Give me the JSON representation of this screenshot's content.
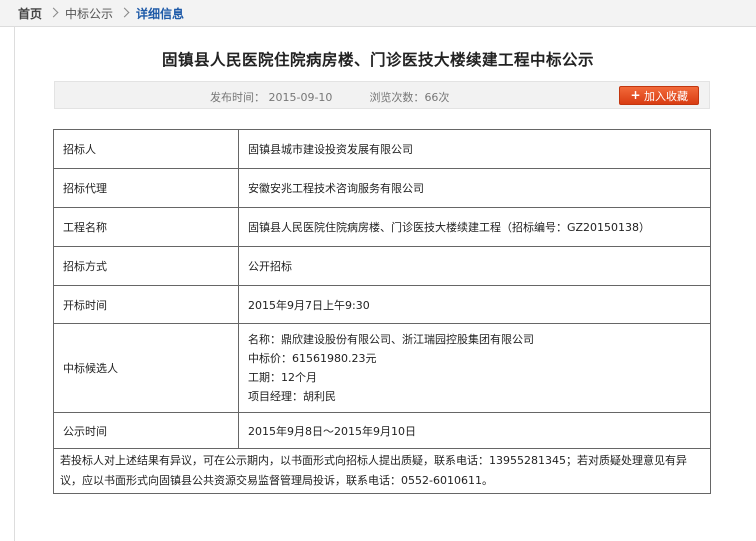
{
  "breadcrumb": {
    "items": [
      "首页",
      "中标公示",
      "详细信息"
    ]
  },
  "article": {
    "title": "固镇县人民医院住院病房楼、门诊医技大楼续建工程中标公示",
    "publish_label": "发布时间：",
    "publish_date": "2015-09-10",
    "views_label": "浏览次数：",
    "views_count": "66次",
    "favorite_button": "加入收藏"
  },
  "table": {
    "rows": [
      {
        "label": "招标人",
        "value": "固镇县城市建设投资发展有限公司"
      },
      {
        "label": "招标代理",
        "value": "安徽安兆工程技术咨询服务有限公司"
      },
      {
        "label": "工程名称",
        "value": "固镇县人民医院住院病房楼、门诊医技大楼续建工程（招标编号：GZ20150138）"
      },
      {
        "label": "招标方式",
        "value": "公开招标"
      },
      {
        "label": "开标时间",
        "value": "2015年9月7日上午9:30"
      }
    ],
    "candidate": {
      "label": "中标候选人",
      "lines": [
        "名称：鼎欣建设股份有限公司、浙江瑞园控股集团有限公司",
        "中标价：61561980.23元",
        "工期：12个月",
        "项目经理：胡利民"
      ]
    },
    "publicity": {
      "label": "公示时间",
      "value": "2015年9月8日～2015年9月10日"
    },
    "note": "若投标人对上述结果有异议，可在公示期内，以书面形式向招标人提出质疑，联系电话：13955281345；若对质疑处理意见有异议，应以书面形式向固镇县公共资源交易监督管理局投诉，联系电话：0552-6010611。"
  },
  "colors": {
    "breadcrumb_current": "#1e5aa8",
    "button_bg": "#e04a1d",
    "border": "#666666"
  },
  "icons": {
    "separator": "chevron-right-icon",
    "favorite": "plus-icon"
  }
}
